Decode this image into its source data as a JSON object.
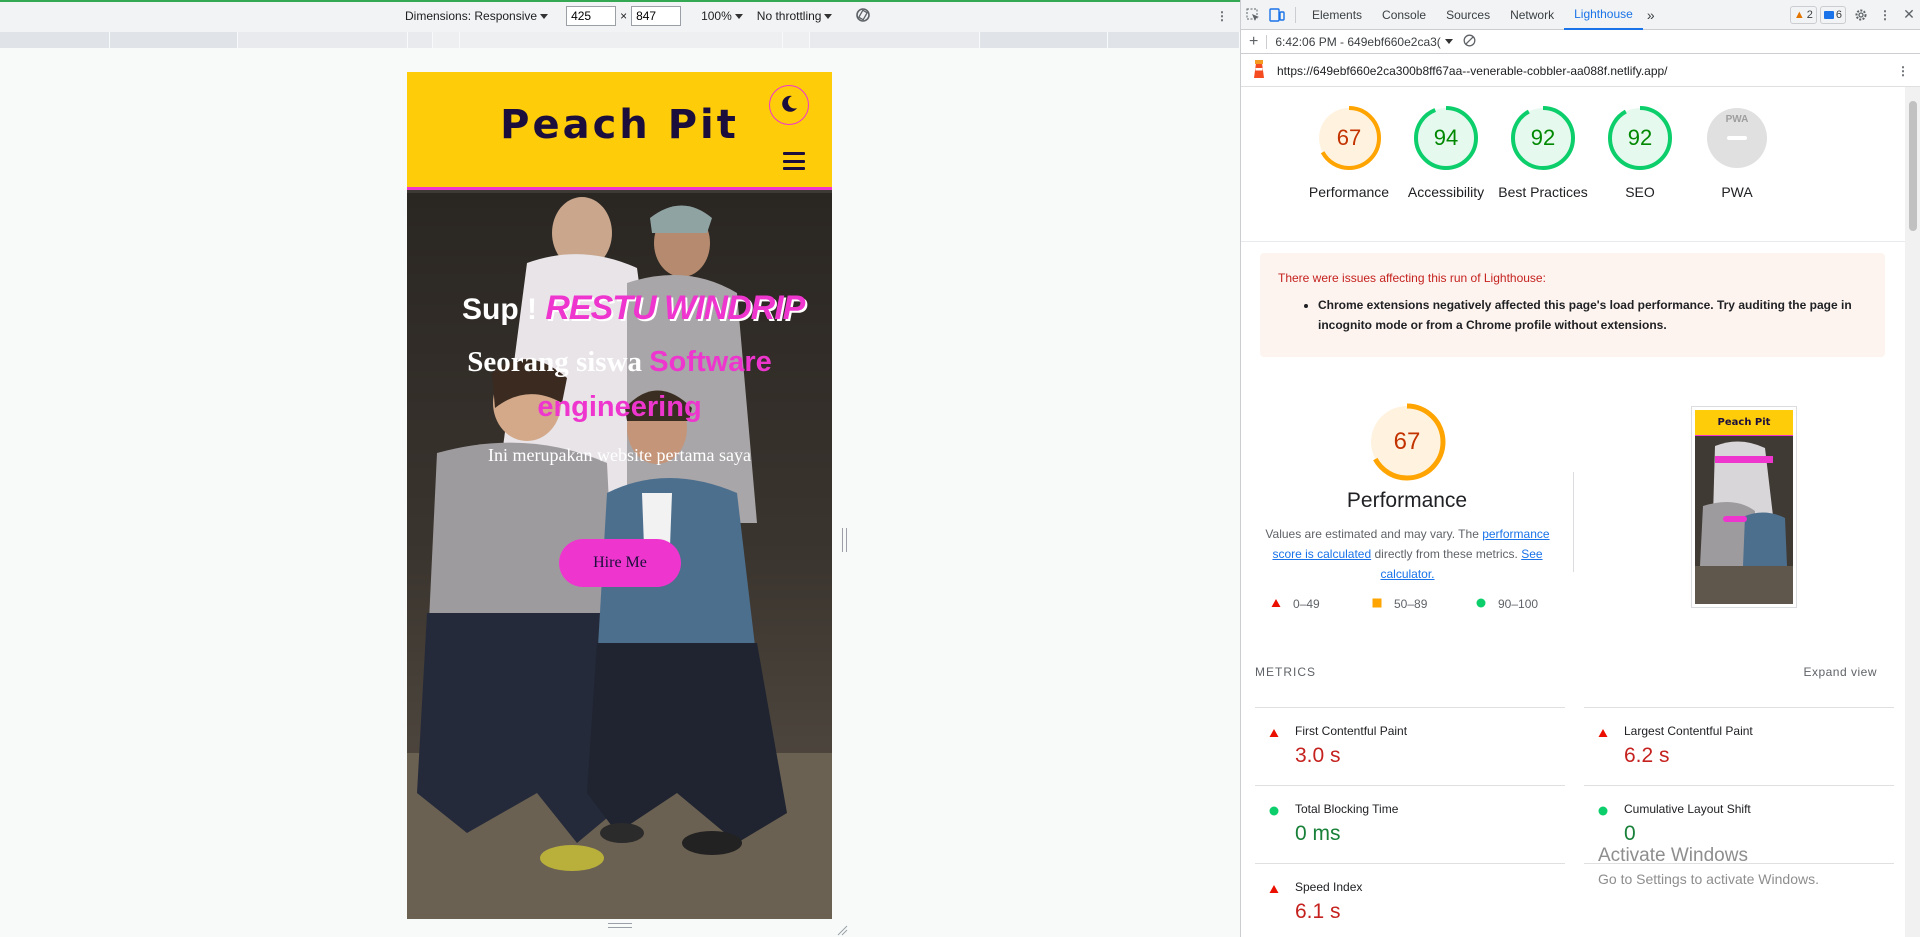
{
  "device_toolbar": {
    "dimensions_label": "Dimensions: Responsive",
    "width": "425",
    "height": "847",
    "x": "×",
    "zoom": "100%",
    "throttle": "No throttling"
  },
  "site": {
    "logo": "Peach Pit",
    "greet": "Sup !",
    "name": "RESTU WINDRIP",
    "role_prefix": "Seorang siswa",
    "role_accent": "Software engineering",
    "description": "Ini merupakan website pertama saya",
    "cta": "Hire Me"
  },
  "devtools": {
    "tabs": [
      "Elements",
      "Console",
      "Sources",
      "Network",
      "Lighthouse"
    ],
    "more": "»",
    "warnings": "2",
    "messages": "6",
    "report_time": "6:42:06 PM - 649ebf660e2ca3(",
    "url": "https://649ebf660e2ca300b8ff67aa--venerable-cobbler-aa088f.netlify.app/"
  },
  "gauges": [
    {
      "label": "Performance",
      "score": "67",
      "value": 67,
      "color": "#ffa400",
      "text_color": "#c33300",
      "fill": "#fff3e0"
    },
    {
      "label": "Accessibility",
      "score": "94",
      "value": 94,
      "color": "#0cce6b",
      "text_color": "#008800",
      "fill": "#e6f9ef"
    },
    {
      "label": "Best Practices",
      "score": "92",
      "value": 92,
      "color": "#0cce6b",
      "text_color": "#008800",
      "fill": "#e6f9ef"
    },
    {
      "label": "SEO",
      "score": "92",
      "value": 92,
      "color": "#0cce6b",
      "text_color": "#008800",
      "fill": "#e6f9ef"
    },
    {
      "label": "PWA",
      "score": "PWA",
      "value": 0,
      "color": "#bdbdbd",
      "text_color": "#9e9e9e",
      "fill": "#e0e0e0"
    }
  ],
  "issues": {
    "title": "There were issues affecting this run of Lighthouse:",
    "items": [
      "Chrome extensions negatively affected this page's load performance. Try auditing the page in incognito mode or from a Chrome profile without extensions."
    ]
  },
  "performance": {
    "score": "67",
    "value": 67,
    "title": "Performance",
    "desc_1": "Values are estimated and may vary. The ",
    "link_1": "performance score is calculated",
    "desc_2": " directly from these metrics. ",
    "link_2": "See calculator.",
    "legend": [
      "0–49",
      "50–89",
      "90–100"
    ],
    "thumb_title": "Peach Pit"
  },
  "metrics": {
    "heading": "METRICS",
    "expand": "Expand view",
    "items": [
      {
        "label": "First Contentful Paint",
        "value": "3.0 s",
        "status": "red"
      },
      {
        "label": "Largest Contentful Paint",
        "value": "6.2 s",
        "status": "red"
      },
      {
        "label": "Total Blocking Time",
        "value": "0 ms",
        "status": "green"
      },
      {
        "label": "Cumulative Layout Shift",
        "value": "0",
        "status": "green"
      },
      {
        "label": "Speed Index",
        "value": "6.1 s",
        "status": "red"
      }
    ]
  },
  "watermark": {
    "title": "Activate Windows",
    "subtitle": "Go to Settings to activate Windows."
  }
}
